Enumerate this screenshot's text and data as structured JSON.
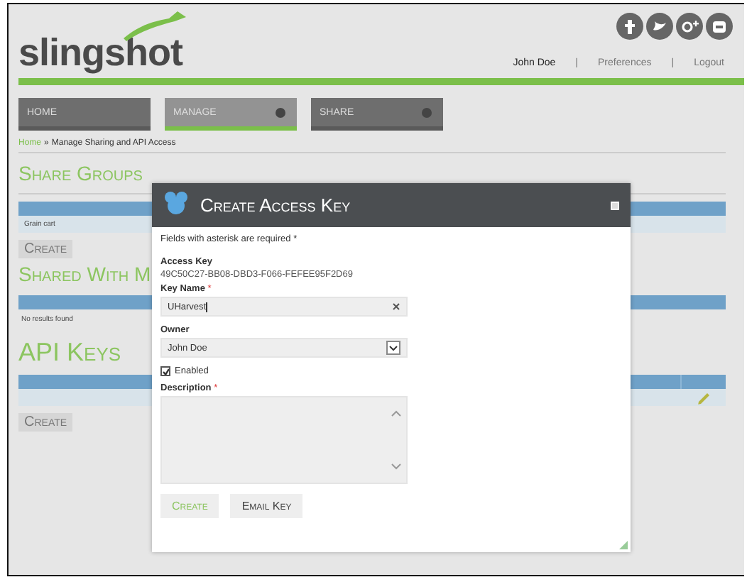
{
  "header": {
    "logo": "slingshot",
    "user_links": [
      {
        "label": "John Doe",
        "current": true
      },
      {
        "label": "Preferences",
        "current": false
      },
      {
        "label": "Logout",
        "current": false
      }
    ],
    "separator": "|"
  },
  "nav_tabs": [
    {
      "label": "HOME",
      "selected": false,
      "has_menu": false
    },
    {
      "label": "MANAGE",
      "selected": true,
      "has_menu": true
    },
    {
      "label": "SHARE",
      "selected": false,
      "has_menu": true
    }
  ],
  "breadcrumb": {
    "items": [
      "Home",
      "Manage Sharing and API Access"
    ],
    "separator": "»"
  },
  "sections": [
    {
      "heading": "Share Groups",
      "rows": [
        {
          "cells": [
            {
              "kind": "text",
              "text": "Grain cart"
            }
          ]
        }
      ],
      "button": "Create"
    },
    {
      "heading": "Shared With M",
      "empty_message": "No results found"
    },
    {
      "heading": "API Keys",
      "rows": [
        {
          "cells": [
            {
              "kind": "blank"
            },
            {
              "kind": "edit"
            }
          ]
        }
      ],
      "button": "Create"
    }
  ],
  "dialog": {
    "title": "Create Access Key",
    "note": "Fields with asterisk are required *",
    "required_mark": "*",
    "fields": [
      {
        "kind": "static",
        "label": "Access Key",
        "value": "49C50C27-BB08-DBD3-F066-FEFEE95F2D69",
        "required": false
      },
      {
        "kind": "text",
        "label": "Key Name",
        "value": "UHarvest",
        "required": true
      },
      {
        "kind": "select",
        "label": "Owner",
        "value": "John Doe",
        "required": false
      },
      {
        "kind": "checkbox",
        "label": "Enabled",
        "checked": true
      },
      {
        "kind": "textarea",
        "label": "Description",
        "required": true
      }
    ],
    "buttons": [
      {
        "label": "Create",
        "primary": true
      },
      {
        "label": "Email Key",
        "primary": false
      }
    ]
  }
}
